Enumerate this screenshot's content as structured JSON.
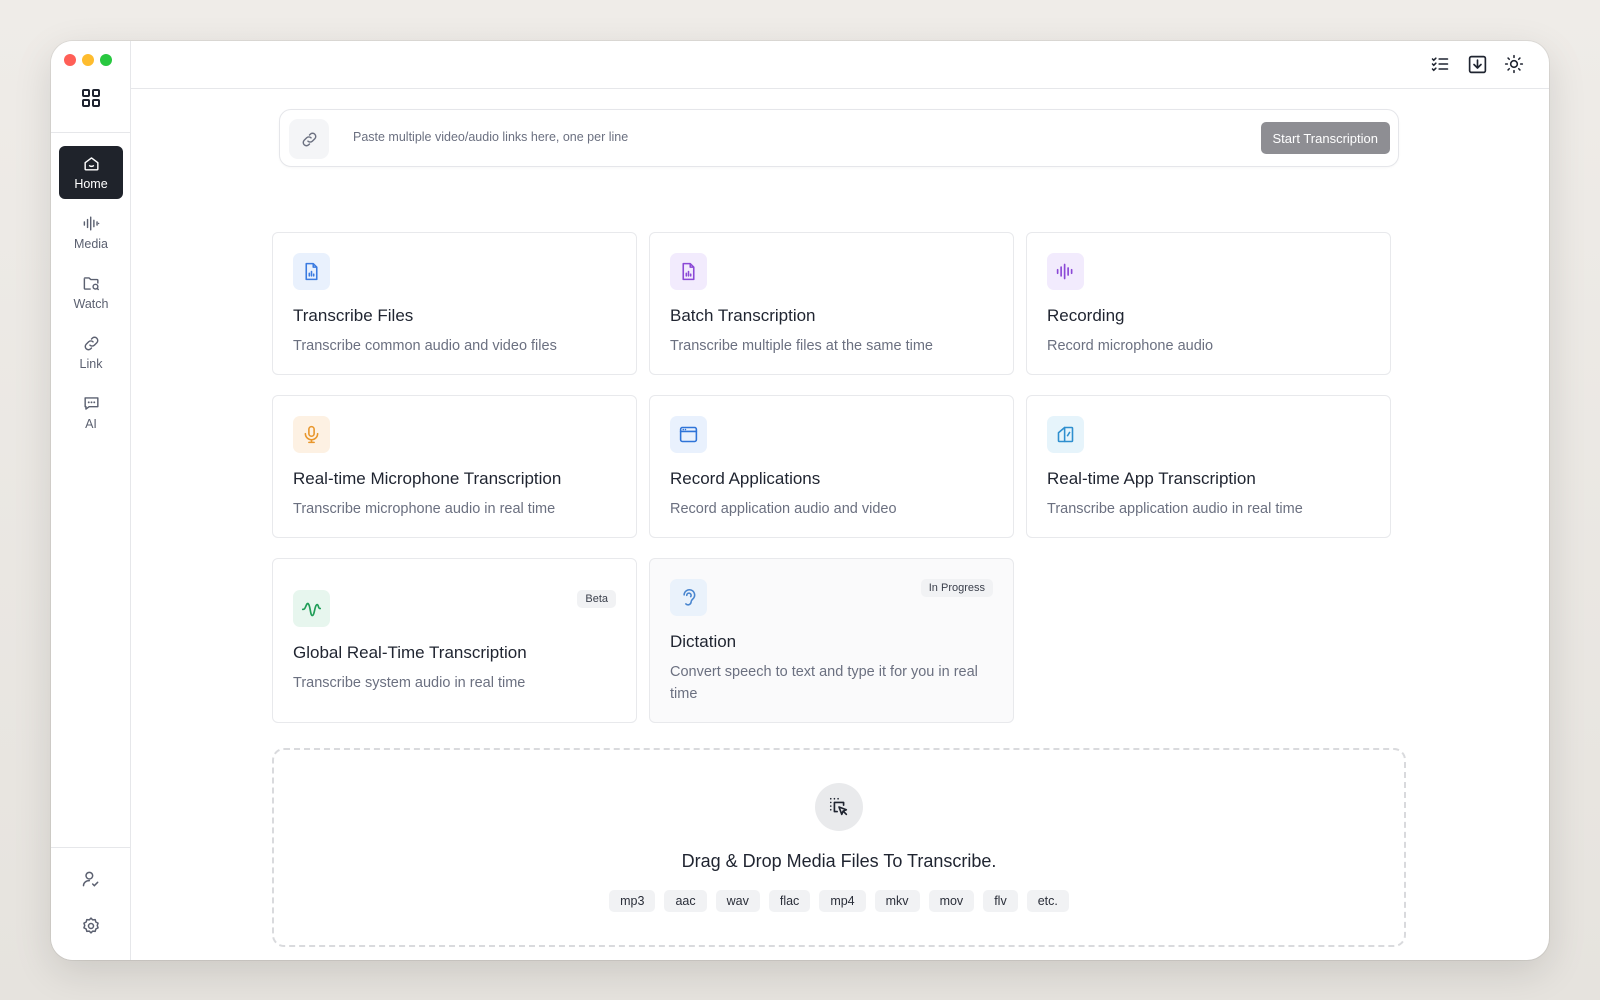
{
  "sidebar": {
    "items": [
      {
        "label": "Home",
        "icon": "home-icon",
        "active": true
      },
      {
        "label": "Media",
        "icon": "waveform-icon"
      },
      {
        "label": "Watch",
        "icon": "folder-search-icon"
      },
      {
        "label": "Link",
        "icon": "link-icon"
      },
      {
        "label": "AI",
        "icon": "chat-icon"
      }
    ],
    "bottom_icons": [
      "user-check-icon",
      "gear-icon"
    ]
  },
  "topbar": {
    "icons": [
      "task-list-icon",
      "download-icon",
      "sun-icon"
    ]
  },
  "link_input": {
    "placeholder": "Paste multiple video/audio links here, one per line",
    "button_label": "Start Transcription",
    "button_color": "#8e8e93"
  },
  "cards": [
    {
      "title": "Transcribe Files",
      "desc": "Transcribe common audio and video files",
      "icon": "file-chart-icon",
      "color": "#3b7be0"
    },
    {
      "title": "Batch Transcription",
      "desc": "Transcribe multiple files at the same time",
      "icon": "file-chart-icon",
      "color": "#8b49d6"
    },
    {
      "title": "Recording",
      "desc": "Record microphone audio",
      "icon": "waveform-icon",
      "color": "#8b49d6"
    },
    {
      "title": "Real-time Microphone Transcription",
      "desc": "Transcribe microphone audio in real time",
      "icon": "microphone-icon",
      "color": "#e8962b"
    },
    {
      "title": "Record Applications",
      "desc": "Record application audio and video",
      "icon": "app-window-icon",
      "color": "#2f74d8"
    },
    {
      "title": "Real-time App Transcription",
      "desc": "Transcribe application audio in real time",
      "icon": "app-layers-icon",
      "color": "#2e8fcf"
    },
    {
      "title": "Global Real-Time Transcription",
      "desc": "Transcribe system audio in real time",
      "icon": "signal-wave-icon",
      "color": "#1f9d57",
      "badge": "Beta"
    },
    {
      "title": "Dictation",
      "desc": "Convert speech to text and type it for you in real time",
      "icon": "ear-icon",
      "color": "#4a86cf",
      "badge": "In Progress"
    }
  ],
  "dropzone": {
    "text": "Drag & Drop Media Files To Transcribe.",
    "icon": "drag-drop-icon",
    "formats": [
      "mp3",
      "aac",
      "wav",
      "flac",
      "mp4",
      "mkv",
      "mov",
      "flv",
      "etc."
    ]
  }
}
